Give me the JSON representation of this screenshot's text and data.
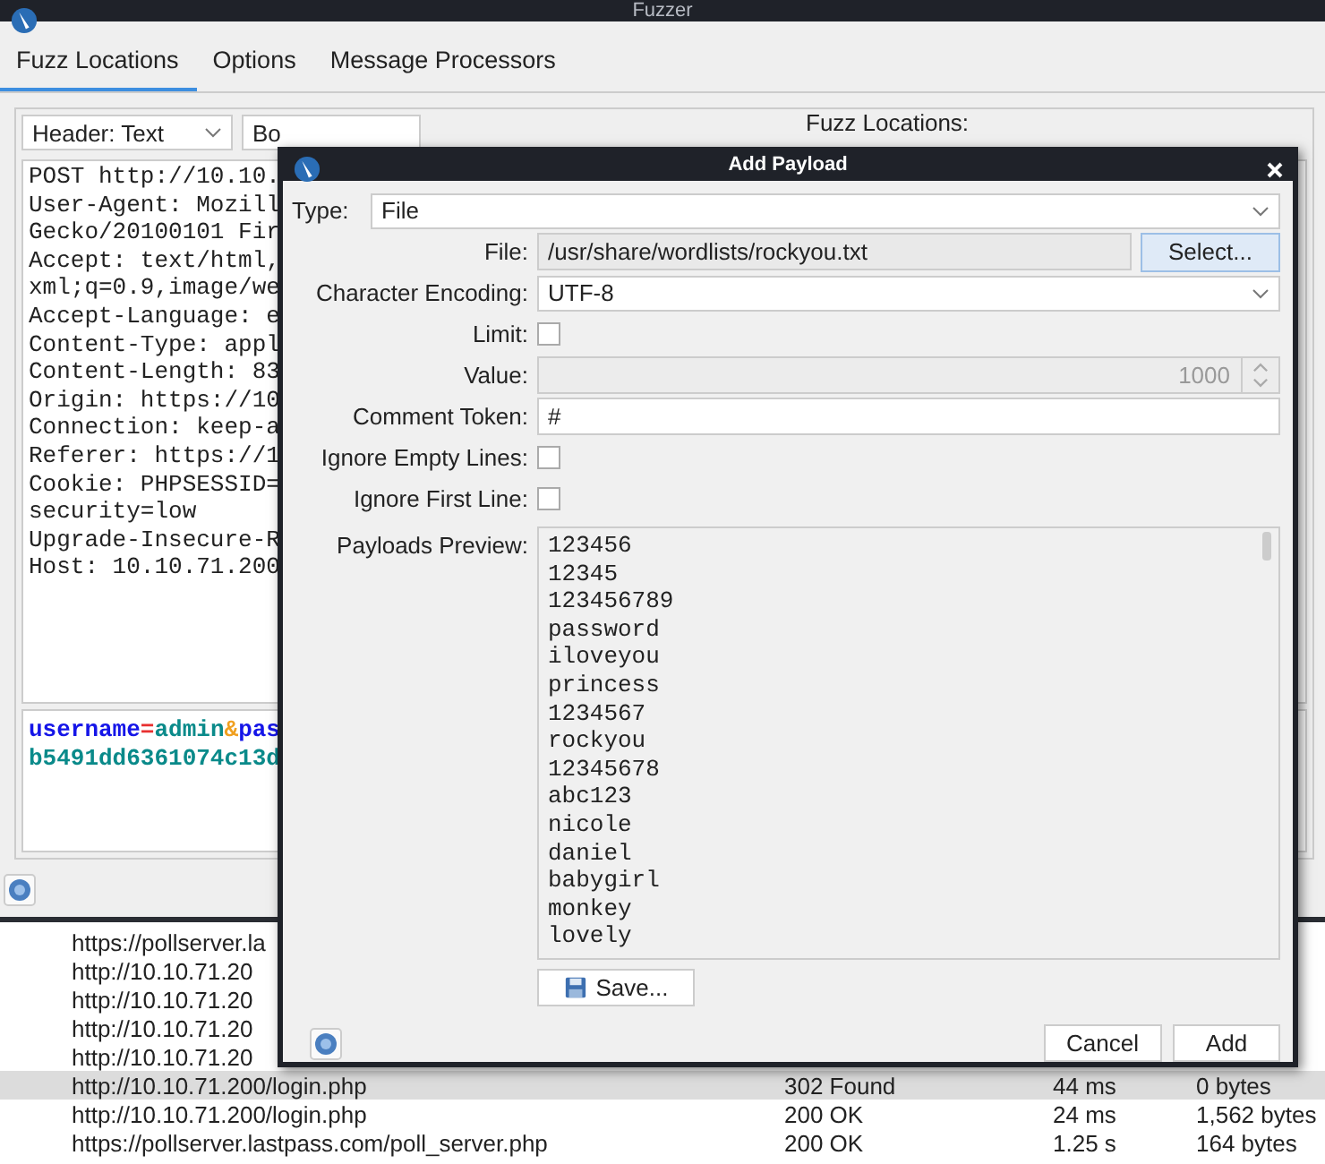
{
  "window": {
    "title": "Fuzzer"
  },
  "tabs": [
    {
      "label": "Fuzz Locations",
      "selected": true
    },
    {
      "label": "Options",
      "selected": false
    },
    {
      "label": "Message Processors",
      "selected": false
    }
  ],
  "editor": {
    "header_view": "Header: Text",
    "body_view": "Bo",
    "locations_label": "Fuzz Locations:",
    "header_lines": [
      "POST http://10.10.",
      "User-Agent: Mozill",
      "Gecko/20100101 Fir",
      "Accept: text/html,",
      "xml;q=0.9,image/we",
      "Accept-Language: e",
      "Content-Type: appl",
      "Content-Length: 83",
      "Origin: https://10",
      "Connection: keep-a",
      "Referer: https://1",
      "Cookie: PHPSESSID=",
      "security=low",
      "Upgrade-Insecure-R",
      "Host: 10.10.71.200"
    ],
    "body_lines": [
      [
        {
          "kind": "key",
          "text": "username"
        },
        {
          "kind": "eq",
          "text": "="
        },
        {
          "kind": "value",
          "text": "admin"
        },
        {
          "kind": "amp",
          "text": "&"
        },
        {
          "kind": "key",
          "text": "pas"
        }
      ],
      [
        {
          "kind": "value",
          "text": "b5491dd6361074c13d"
        }
      ]
    ]
  },
  "results": [
    {
      "url": "https://pollserver.la",
      "selected": false
    },
    {
      "url": "http://10.10.71.20",
      "selected": false
    },
    {
      "url": "http://10.10.71.20",
      "selected": false
    },
    {
      "url": "http://10.10.71.20",
      "selected": false
    },
    {
      "url": "http://10.10.71.20",
      "selected": false
    },
    {
      "url": "http://10.10.71.200/login.php",
      "status": "302 Found",
      "time": "44 ms",
      "size": "0 bytes",
      "selected": true
    },
    {
      "url": "http://10.10.71.200/login.php",
      "status": "200 OK",
      "time": "24 ms",
      "size": "1,562 bytes",
      "selected": false
    },
    {
      "url": "https://pollserver.lastpass.com/poll_server.php",
      "status": "200 OK",
      "time": "1.25 s",
      "size": "164 bytes",
      "selected": false
    }
  ],
  "dialog": {
    "title": "Add Payload",
    "type_label": "Type:",
    "type": "File",
    "fields": [
      {
        "kind": "file",
        "label": "File:",
        "value": "/usr/share/wordlists/rockyou.txt",
        "button": "Select..."
      },
      {
        "kind": "select",
        "label": "Character Encoding:",
        "value": "UTF-8"
      },
      {
        "kind": "checkbox",
        "label": "Limit:",
        "checked": false
      },
      {
        "kind": "spinner",
        "label": "Value:",
        "value": "1000",
        "disabled": true
      },
      {
        "kind": "text",
        "label": "Comment Token:",
        "value": "#"
      },
      {
        "kind": "checkbox",
        "label": "Ignore Empty Lines:",
        "checked": false
      },
      {
        "kind": "checkbox",
        "label": "Ignore First Line:",
        "checked": false
      }
    ],
    "preview_label": "Payloads Preview:",
    "preview": [
      "123456",
      "12345",
      "123456789",
      "password",
      "iloveyou",
      "princess",
      "1234567",
      "rockyou",
      "12345678",
      "abc123",
      "nicole",
      "daniel",
      "babygirl",
      "monkey",
      "lovely"
    ],
    "save_button": "Save...",
    "cancel_button": "Cancel",
    "add_button": "Add"
  }
}
